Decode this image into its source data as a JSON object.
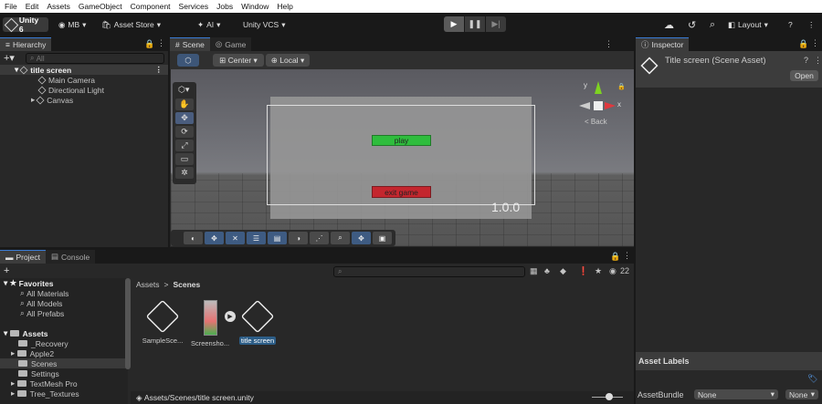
{
  "menu": [
    "File",
    "Edit",
    "Assets",
    "GameObject",
    "Component",
    "Services",
    "Jobs",
    "Window",
    "Help"
  ],
  "toolbar": {
    "unity": "Unity 6",
    "account": "MB",
    "asset_store": "Asset Store",
    "ai": "AI",
    "vcs": "Unity VCS",
    "layout": "Layout"
  },
  "hierarchy": {
    "tab": "Hierarchy",
    "search_placeholder": "All",
    "scene": "title screen",
    "items": [
      "Main Camera",
      "Directional Light",
      "Canvas"
    ]
  },
  "scene": {
    "tab_scene": "Scene",
    "tab_game": "Game",
    "pivot": "Center",
    "space": "Local",
    "play_label": "play",
    "exit_label": "exit game",
    "version": "1.0.0",
    "back": "< Back",
    "axis_x": "x",
    "axis_y": "y"
  },
  "inspector": {
    "tab": "Inspector",
    "title": "Title screen (Scene Asset)",
    "open": "Open",
    "asset_labels": "Asset Labels",
    "asset_bundle": "AssetBundle",
    "bundle_value": "None",
    "variant_value": "None"
  },
  "project": {
    "tab_project": "Project",
    "tab_console": "Console",
    "hidden_count": "22",
    "breadcrumb_root": "Assets",
    "breadcrumb_sep": ">",
    "breadcrumb_current": "Scenes",
    "path": "Assets/Scenes/title screen.unity",
    "favorites": {
      "label": "Favorites",
      "items": [
        "All Materials",
        "All Models",
        "All Prefabs"
      ]
    },
    "tree": {
      "label": "Assets",
      "items": [
        "_Recovery",
        "Apple2",
        "Scenes",
        "Settings",
        "TextMesh Pro",
        "Tree_Textures"
      ]
    },
    "assets": [
      "SampleSce...",
      "Screensho...",
      "title screen"
    ]
  },
  "colors": {
    "accent": "#3a7bd5",
    "play_btn": "#2fbd3d",
    "exit_btn": "#c4262e",
    "selection": "#2c5d87"
  }
}
